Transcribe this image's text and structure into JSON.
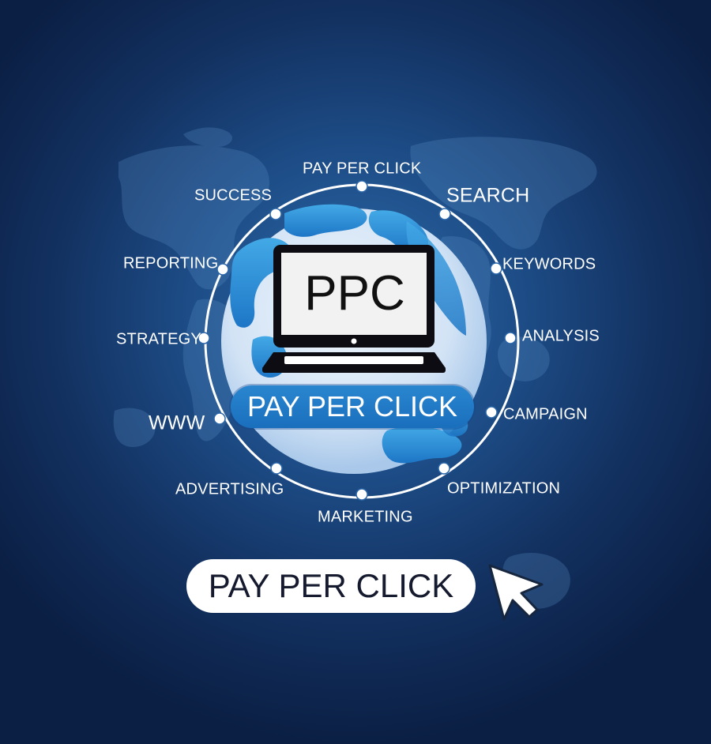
{
  "screen": {
    "icon": "laptop-icon",
    "ppc_text": "PPC",
    "center_banner": "PAY PER CLICK",
    "cta_button": "PAY PER CLICK",
    "cursor_icon": "mouse-pointer-icon"
  },
  "ring_labels": {
    "top": "PAY PER CLICK",
    "search": "SEARCH",
    "keywords": "KEYWORDS",
    "analysis": "ANALYSIS",
    "campaign": "CAMPAIGN",
    "optimization": "OPTIMIZATION",
    "marketing": "MARKETING",
    "advertising": "ADVERTISING",
    "www": "WWW",
    "strategy": "STRATEGY",
    "reporting": "REPORTING",
    "success": "SUCCESS"
  },
  "colors": {
    "background_dark": "#0b1f44",
    "background_mid": "#1d4c86",
    "globe_light": "#d7e6f6",
    "globe_blue": "#2a8fd6",
    "banner_blue": "#1a6fbd",
    "white": "#ffffff",
    "cta_text": "#151a2e"
  }
}
